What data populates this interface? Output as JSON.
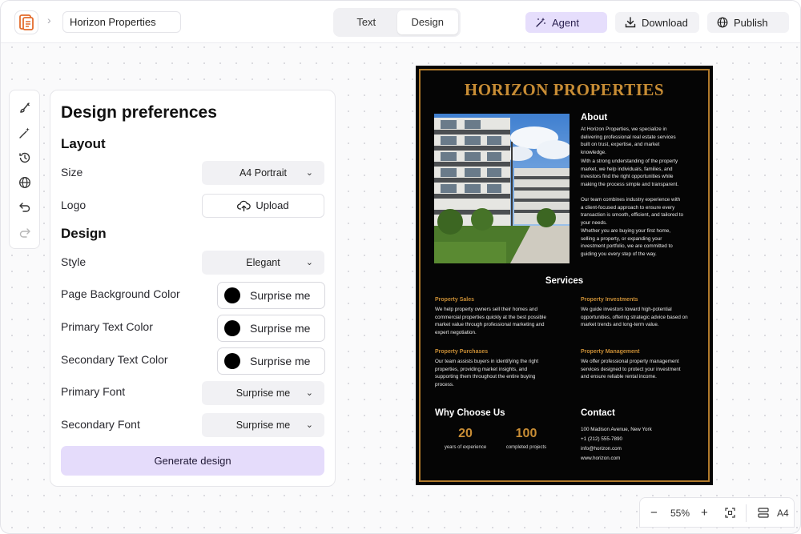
{
  "header": {
    "project_name": "Horizon Properties",
    "mode_tabs": [
      {
        "label": "Text",
        "active": false
      },
      {
        "label": "Design",
        "active": true
      }
    ],
    "agent_label": "Agent",
    "download_label": "Download",
    "publish_label": "Publish",
    "accent_color": "#e6defc"
  },
  "tools": [
    "brush-icon",
    "magic-wand-icon",
    "history-icon",
    "globe-icon",
    "undo-icon",
    "redo-icon"
  ],
  "panel": {
    "title": "Design preferences",
    "layout_heading": "Layout",
    "size_label": "Size",
    "size_value": "A4 Portrait",
    "logo_label": "Logo",
    "upload_label": "Upload",
    "design_heading": "Design",
    "style_label": "Style",
    "style_value": "Elegant",
    "page_bg_label": "Page Background Color",
    "primary_text_label": "Primary Text Color",
    "secondary_text_label": "Secondary Text Color",
    "surprise_label": "Surprise me",
    "swatch_color": "#000000",
    "primary_font_label": "Primary Font",
    "primary_font_value": "Surprise me",
    "secondary_font_label": "Secondary Font",
    "secondary_font_value": "Surprise me",
    "generate_label": "Generate design"
  },
  "flyer": {
    "title": "HORIZON PROPERTIES",
    "about_heading": "About",
    "about_p1": "At Horizon Properties, we specialize in delivering professional real estate services built on trust, expertise, and market knowledge.",
    "about_p2": "With a strong understanding of the property market, we help individuals, families, and investors find the right opportunities while making the process simple and transparent.",
    "about_p3": "Our team combines industry experience with a client-focused approach to ensure every transaction is smooth, efficient, and tailored to your needs.",
    "about_p4": "Whether you are buying your first home, selling a property, or expanding your investment portfolio, we are committed to guiding you every step of the way.",
    "services_heading": "Services",
    "services": [
      {
        "title": "Property Sales",
        "text": "We help property owners sell their homes and commercial properties quickly at the best possible market value through professional marketing and expert negotiation."
      },
      {
        "title": "Property Investments",
        "text": "We guide investors toward high-potential opportunities, offering strategic advice based on market trends and long-term value."
      },
      {
        "title": "Property Purchases",
        "text": "Our team assists buyers in identifying the right properties, providing market insights, and supporting them throughout the entire buying process."
      },
      {
        "title": "Property Management",
        "text": "We offer professional property management services designed to protect your investment and ensure reliable rental income."
      }
    ],
    "why_heading": "Why Choose Us",
    "stats": [
      {
        "value": "20",
        "label": "years of experience"
      },
      {
        "value": "100",
        "label": "completed projects"
      }
    ],
    "contact_heading": "Contact",
    "contact_lines": [
      "100 Madison Avenue, New York",
      "+1 (212) 555-7890",
      "info@horizon.com",
      "www.horizon.com"
    ],
    "bg_color": "#050505",
    "gold_color": "#c88d35"
  },
  "zoom": {
    "minus": "−",
    "level": "55%",
    "plus": "+",
    "page_size": "A4"
  }
}
